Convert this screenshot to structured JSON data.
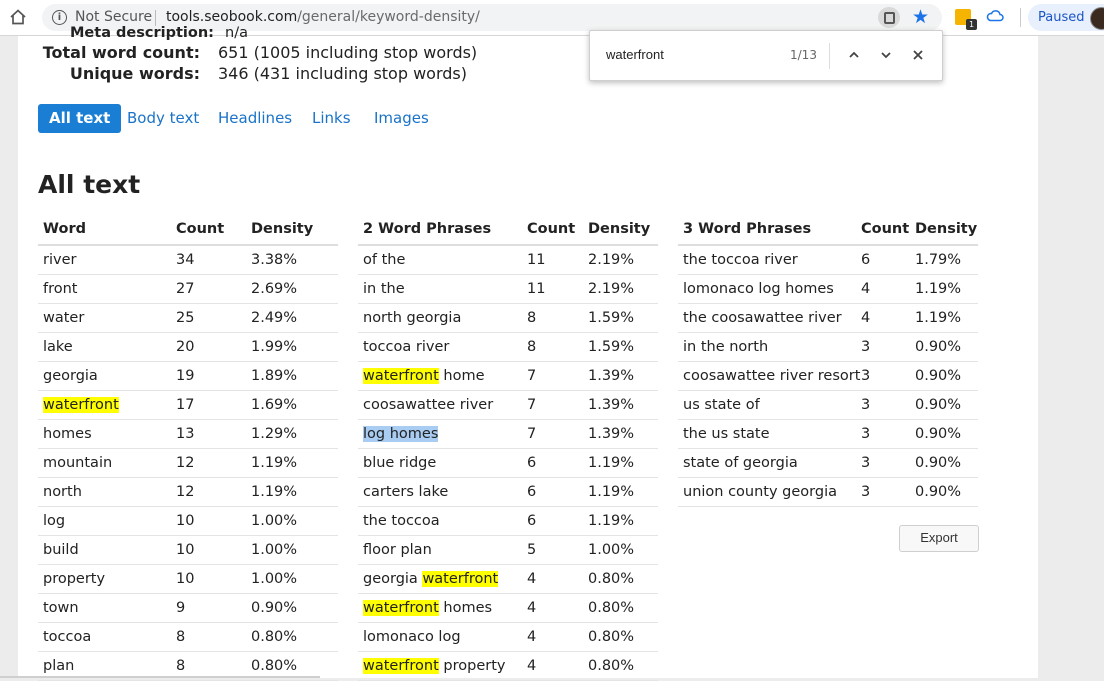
{
  "browser": {
    "security_label": "Not Secure",
    "url_host": "tools.seobook.com",
    "url_path": "/general/keyword-density/",
    "extension_badge": "1",
    "profile_status": "Paused"
  },
  "find_bar": {
    "query": "waterfront",
    "count": "1/13"
  },
  "stats": {
    "cut_label": "Meta description:",
    "cut_value": "n/a",
    "rows": [
      {
        "label": "Total word count:",
        "value": "651 (1005 including stop words)"
      },
      {
        "label": "Unique words:",
        "value": "346 (431 including stop words)"
      }
    ]
  },
  "tabs": [
    "All text",
    "Body text",
    "Headlines",
    "Links",
    "Images"
  ],
  "section_title": "All text",
  "tables": {
    "words": {
      "headers": [
        "Word",
        "Count",
        "Density"
      ],
      "rows": [
        [
          "river",
          "34",
          "3.38%"
        ],
        [
          "front",
          "27",
          "2.69%"
        ],
        [
          "water",
          "25",
          "2.49%"
        ],
        [
          "lake",
          "20",
          "1.99%"
        ],
        [
          "georgia",
          "19",
          "1.89%"
        ],
        [
          "waterfront",
          "17",
          "1.69%"
        ],
        [
          "homes",
          "13",
          "1.29%"
        ],
        [
          "mountain",
          "12",
          "1.19%"
        ],
        [
          "north",
          "12",
          "1.19%"
        ],
        [
          "log",
          "10",
          "1.00%"
        ],
        [
          "build",
          "10",
          "1.00%"
        ],
        [
          "property",
          "10",
          "1.00%"
        ],
        [
          "town",
          "9",
          "0.90%"
        ],
        [
          "toccoa",
          "8",
          "0.80%"
        ],
        [
          "plan",
          "8",
          "0.80%"
        ]
      ]
    },
    "two_word": {
      "headers": [
        "2 Word Phrases",
        "Count",
        "Density"
      ],
      "rows": [
        [
          "of the",
          "11",
          "2.19%"
        ],
        [
          "in the",
          "11",
          "2.19%"
        ],
        [
          "north georgia",
          "8",
          "1.59%"
        ],
        [
          "toccoa river",
          "8",
          "1.59%"
        ],
        [
          "waterfront home",
          "7",
          "1.39%"
        ],
        [
          "coosawattee river",
          "7",
          "1.39%"
        ],
        [
          "log homes",
          "7",
          "1.39%"
        ],
        [
          "blue ridge",
          "6",
          "1.19%"
        ],
        [
          "carters lake",
          "6",
          "1.19%"
        ],
        [
          "the toccoa",
          "6",
          "1.19%"
        ],
        [
          "floor plan",
          "5",
          "1.00%"
        ],
        [
          "georgia waterfront",
          "4",
          "0.80%"
        ],
        [
          "waterfront homes",
          "4",
          "0.80%"
        ],
        [
          "lomonaco log",
          "4",
          "0.80%"
        ],
        [
          "waterfront property",
          "4",
          "0.80%"
        ]
      ]
    },
    "three_word": {
      "headers": [
        "3 Word Phrases",
        "Count",
        "Density"
      ],
      "rows": [
        [
          "the toccoa river",
          "6",
          "1.79%"
        ],
        [
          "lomonaco log homes",
          "4",
          "1.19%"
        ],
        [
          "the coosawattee river",
          "4",
          "1.19%"
        ],
        [
          "in the north",
          "3",
          "0.90%"
        ],
        [
          "coosawattee river resort",
          "3",
          "0.90%"
        ],
        [
          "us state of",
          "3",
          "0.90%"
        ],
        [
          "the us state",
          "3",
          "0.90%"
        ],
        [
          "state of georgia",
          "3",
          "0.90%"
        ],
        [
          "union county georgia",
          "3",
          "0.90%"
        ]
      ]
    }
  },
  "export_label": "Export",
  "colors": {
    "find_highlight": "#ffff00",
    "selection": "#a9cdf2",
    "accent": "#1a7fd4",
    "link": "#1a73c8"
  }
}
